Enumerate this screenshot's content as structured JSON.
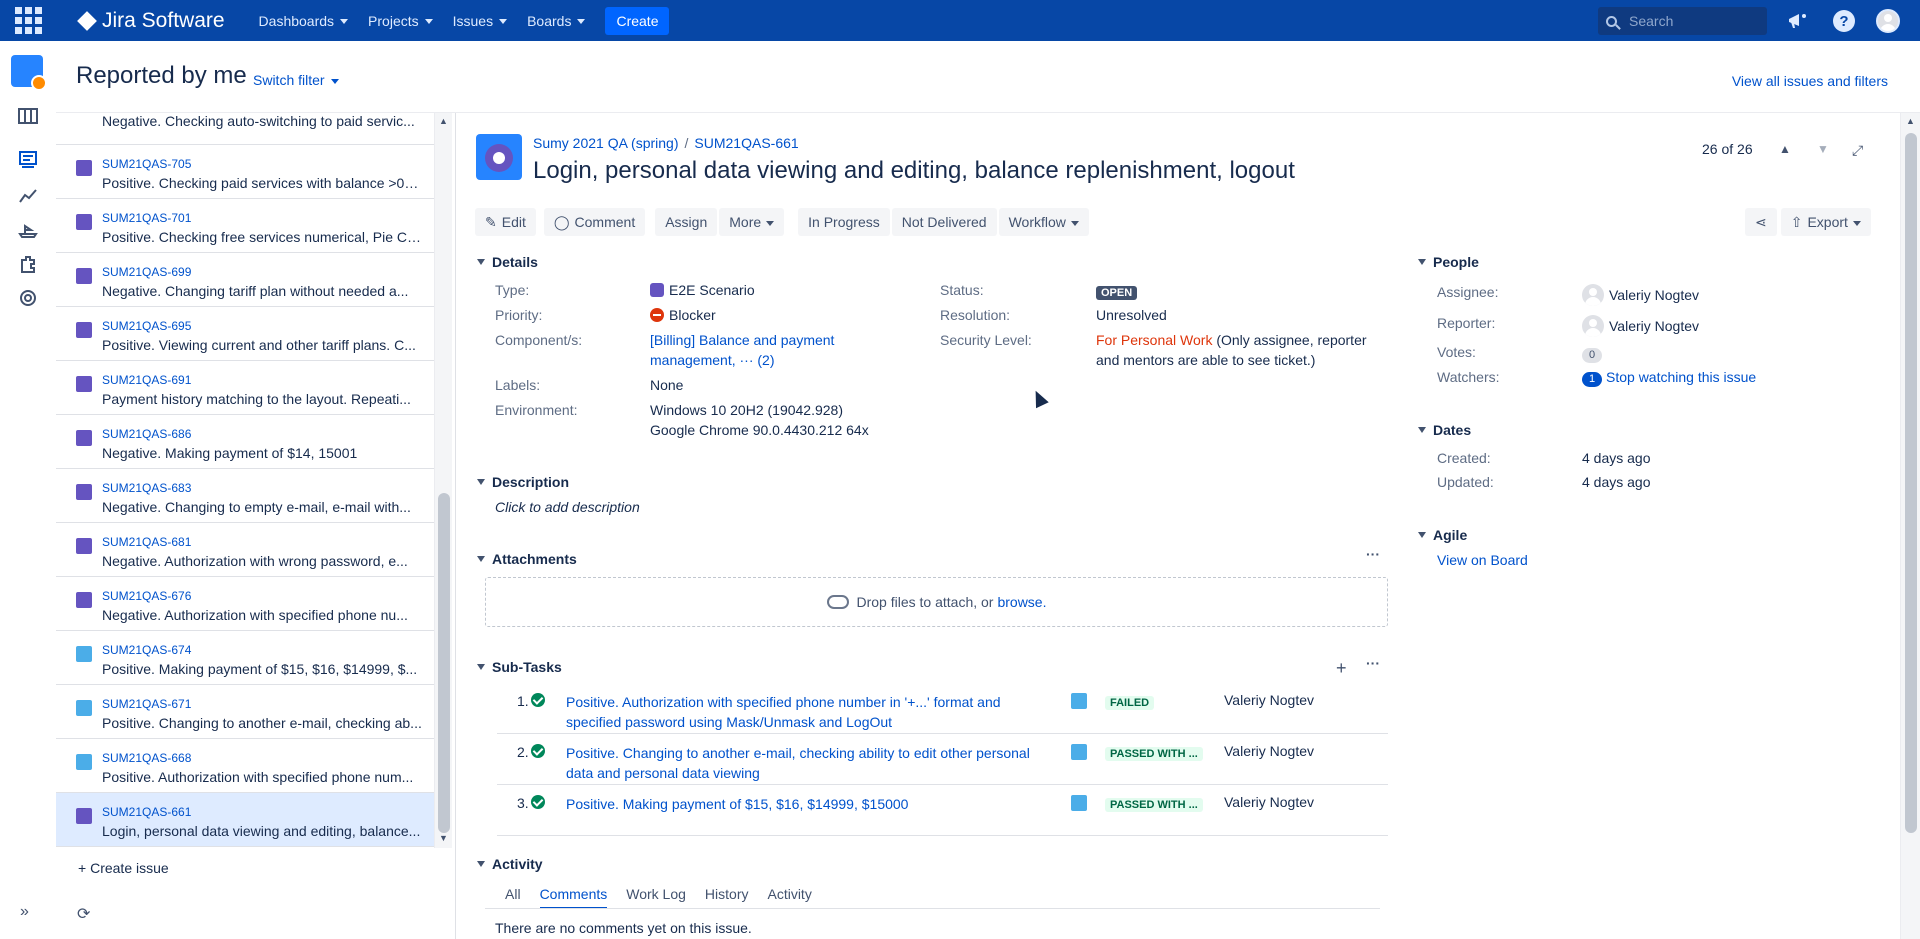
{
  "topnav": {
    "logo": "Jira Software",
    "menus": [
      "Dashboards",
      "Projects",
      "Issues",
      "Boards"
    ],
    "create": "Create",
    "search_placeholder": "Search"
  },
  "header": {
    "title": "Reported by me",
    "switch_filter": "Switch filter",
    "view_all": "View all issues and filters"
  },
  "issue_list": [
    {
      "key": "",
      "summary": "Negative. Checking auto-switching to paid servic...",
      "type": "story"
    },
    {
      "key": "SUM21QAS-705",
      "summary": "Positive. Checking paid services with balance >0, ...",
      "type": "story"
    },
    {
      "key": "SUM21QAS-701",
      "summary": "Positive. Checking free services numerical, Pie Ch...",
      "type": "story"
    },
    {
      "key": "SUM21QAS-699",
      "summary": "Negative. Changing tariff plan without needed a...",
      "type": "story"
    },
    {
      "key": "SUM21QAS-695",
      "summary": "Positive. Viewing current and other tariff plans. C...",
      "type": "story"
    },
    {
      "key": "SUM21QAS-691",
      "summary": "Payment history matching to the layout. Repeati...",
      "type": "story"
    },
    {
      "key": "SUM21QAS-686",
      "summary": "Negative. Making payment of $14, 15001",
      "type": "story"
    },
    {
      "key": "SUM21QAS-683",
      "summary": "Negative. Changing to empty e-mail, e-mail with...",
      "type": "story"
    },
    {
      "key": "SUM21QAS-681",
      "summary": "Negative. Authorization with wrong password, e...",
      "type": "story"
    },
    {
      "key": "SUM21QAS-676",
      "summary": "Negative. Authorization with specified phone nu...",
      "type": "story"
    },
    {
      "key": "SUM21QAS-674",
      "summary": "Positive. Making payment of $15, $16, $14999, $...",
      "type": "subtask"
    },
    {
      "key": "SUM21QAS-671",
      "summary": "Positive. Changing to another e-mail, checking ab...",
      "type": "subtask"
    },
    {
      "key": "SUM21QAS-668",
      "summary": "Positive. Authorization with specified phone num...",
      "type": "subtask"
    },
    {
      "key": "SUM21QAS-661",
      "summary": "Login, personal data viewing and editing, balance...",
      "type": "e2e",
      "selected": true
    }
  ],
  "list_footer": {
    "create_issue": "Create issue"
  },
  "issue": {
    "project": "Sumy 2021 QA (spring)",
    "key": "SUM21QAS-661",
    "title": "Login, personal data viewing and editing, balance replenishment, logout",
    "pager": "26 of 26"
  },
  "toolbar": {
    "edit": "Edit",
    "comment": "Comment",
    "assign": "Assign",
    "more": "More",
    "in_progress": "In Progress",
    "not_delivered": "Not Delivered",
    "workflow": "Workflow",
    "export": "Export"
  },
  "details": {
    "heading": "Details",
    "type_label": "Type:",
    "type_value": "E2E Scenario",
    "priority_label": "Priority:",
    "priority_value": "Blocker",
    "components_label": "Component/s:",
    "components_line1": "[Billing] Balance and payment",
    "components_line2": "management,",
    "components_more": "··· (2)",
    "labels_label": "Labels:",
    "labels_value": "None",
    "environment_label": "Environment:",
    "environment_line1": "Windows 10 20H2 (19042.928)",
    "environment_line2": "Google Chrome 90.0.4430.212 64x",
    "status_label": "Status:",
    "status_value": "OPEN",
    "resolution_label": "Resolution:",
    "resolution_value": "Unresolved",
    "security_label": "Security Level:",
    "security_value": "For Personal Work",
    "security_note_1": "(Only assignee, reporter",
    "security_note_2": "and mentors are able to see ticket.)"
  },
  "description": {
    "heading": "Description",
    "placeholder": "Click to add description"
  },
  "attachments": {
    "heading": "Attachments",
    "drop_text": "Drop files to attach, or",
    "browse": "browse."
  },
  "subtasks": {
    "heading": "Sub-Tasks",
    "items": [
      {
        "num": "1.",
        "line1": "Positive. Authorization with specified phone number in '+...' format and",
        "line2": "specified password using Mask/Unmask and LogOut",
        "status": "FAILED",
        "assignee": "Valeriy Nogtev"
      },
      {
        "num": "2.",
        "line1": "Positive. Changing to another e-mail, checking ability to edit other personal",
        "line2": "data and personal data viewing",
        "status": "PASSED WITH ...",
        "assignee": "Valeriy Nogtev"
      },
      {
        "num": "3.",
        "line1": "Positive. Making payment of $15, $16, $14999, $15000",
        "line2": "",
        "status": "PASSED WITH ...",
        "assignee": "Valeriy Nogtev"
      }
    ]
  },
  "activity": {
    "heading": "Activity",
    "tabs": [
      "All",
      "Comments",
      "Work Log",
      "History",
      "Activity"
    ],
    "empty": "There are no comments yet on this issue."
  },
  "people": {
    "heading": "People",
    "assignee_label": "Assignee:",
    "assignee": "Valeriy Nogtev",
    "reporter_label": "Reporter:",
    "reporter": "Valeriy Nogtev",
    "votes_label": "Votes:",
    "votes": "0",
    "watchers_label": "Watchers:",
    "watchers": "1",
    "stop_watching": "Stop watching this issue"
  },
  "dates": {
    "heading": "Dates",
    "created_label": "Created:",
    "created": "4 days ago",
    "updated_label": "Updated:",
    "updated": "4 days ago"
  },
  "agile": {
    "heading": "Agile",
    "view_on_board": "View on Board"
  },
  "colors": {
    "nav": "#0747a6",
    "link": "#0052cc",
    "create": "#0065ff"
  }
}
